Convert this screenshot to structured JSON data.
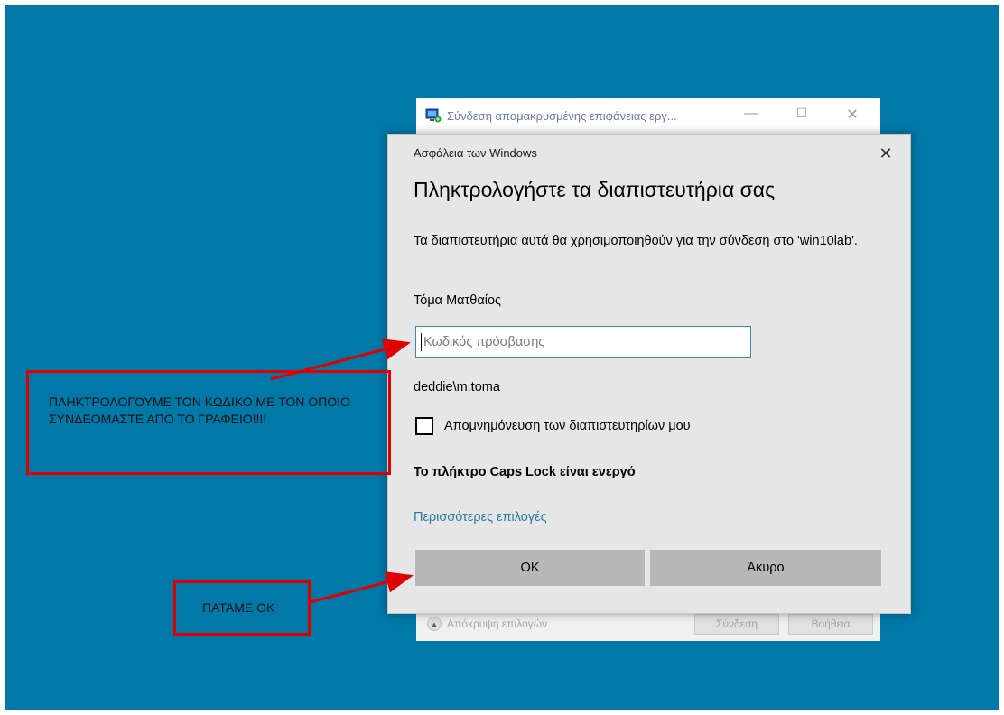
{
  "rdp_window": {
    "title": "Σύνδεση απομακρυσμένης επιφάνειας εργ...",
    "minimize": "—",
    "maximize": "☐",
    "close": "✕",
    "hide_options": "Απόκρυψη επιλογών",
    "connect_button": "Σύνδεση",
    "help_button": "Βοήθεια"
  },
  "dialog": {
    "app_name": "Ασφάλεια των Windows",
    "close": "✕",
    "title": "Πληκτρολογήστε τα διαπιστευτήρια σας",
    "description": "Τα διαπιστευτήρια αυτά θα χρησιμοποιηθούν για την σύνδεση στο 'win10lab'.",
    "user_display_name": "Τόμα Ματθαίος",
    "password_placeholder": "Κωδικός πρόσβασης",
    "password_value": "",
    "domain_user": "deddie\\m.toma",
    "remember_label": "Απομνημόνευση των διαπιστευτηρίων μου",
    "remember_checked": false,
    "caps_warning": "Το πλήκτρο Caps Lock είναι ενεργό",
    "more_options": "Περισσότερες επιλογές",
    "ok_button": "OK",
    "cancel_button": "Άκυρο"
  },
  "annotations": {
    "password_note": "ΠΛΗΚΤΡΟΛΟΓΟΥΜΕ ΤΟΝ ΚΩΔΙΚΟ ΜΕ ΤΟΝ ΟΠΟΙΟ ΣΥΝΔΕΟΜΑΣΤΕ ΑΠΟ ΤΟ ΓΡΑΦΕΙΟ!!!!",
    "ok_note": "ΠΑΤΑΜΕ ΟΚ"
  },
  "colors": {
    "desktop": "#0078a8",
    "annotation": "#e00000",
    "link": "#2b7a9f",
    "input_border": "#3c8aa6"
  }
}
